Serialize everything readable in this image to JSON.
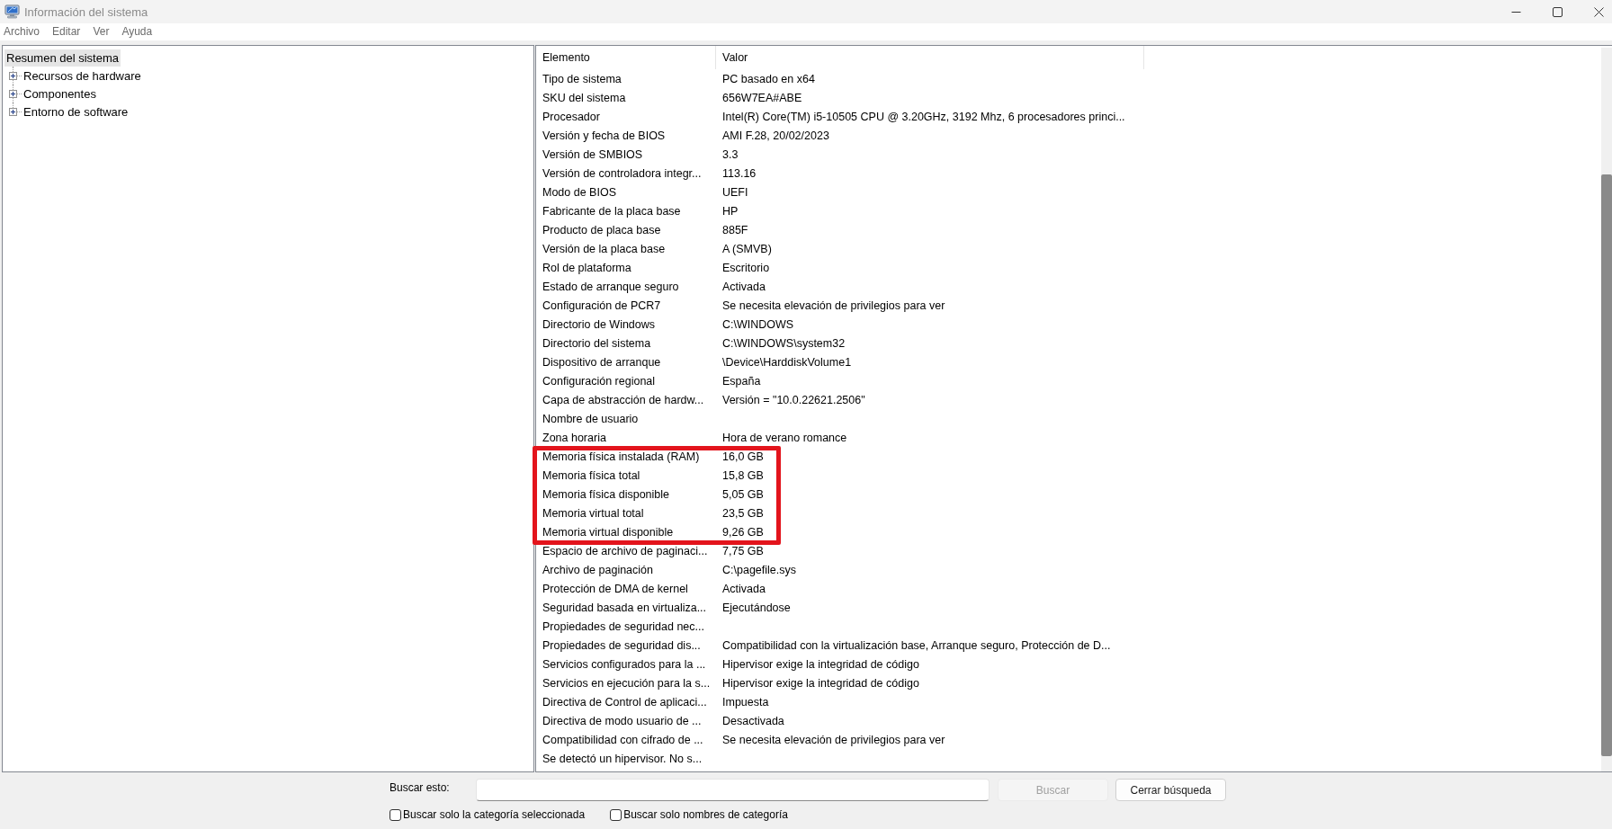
{
  "window": {
    "title": "Información del sistema"
  },
  "menu": [
    "Archivo",
    "Editar",
    "Ver",
    "Ayuda"
  ],
  "tree": [
    {
      "label": "Resumen del sistema",
      "selected": true,
      "children": [
        {
          "label": "Recursos de hardware",
          "selected": false,
          "expanded": false
        },
        {
          "label": "Componentes",
          "selected": false,
          "expanded": false
        },
        {
          "label": "Entorno de software",
          "selected": false,
          "expanded": false
        }
      ]
    }
  ],
  "table": {
    "columns": [
      "Elemento",
      "Valor"
    ],
    "rows": [
      {
        "element": "Tipo de sistema",
        "value": "PC basado en x64",
        "highlighted": false
      },
      {
        "element": "SKU del sistema",
        "value": "656W7EA#ABE",
        "highlighted": false
      },
      {
        "element": "Procesador",
        "value": "Intel(R) Core(TM) i5-10505 CPU @ 3.20GHz, 3192 Mhz, 6 procesadores princi...",
        "highlighted": false
      },
      {
        "element": "Versión y fecha de BIOS",
        "value": "AMI F.28, 20/02/2023",
        "highlighted": false
      },
      {
        "element": "Versión de SMBIOS",
        "value": "3.3",
        "highlighted": false
      },
      {
        "element": "Versión de controladora integr...",
        "value": "113.16",
        "highlighted": false
      },
      {
        "element": "Modo de BIOS",
        "value": "UEFI",
        "highlighted": false
      },
      {
        "element": "Fabricante de la placa base",
        "value": "HP",
        "highlighted": false
      },
      {
        "element": "Producto de placa base",
        "value": "885F",
        "highlighted": false
      },
      {
        "element": "Versión de la placa base",
        "value": "A (SMVB)",
        "highlighted": false
      },
      {
        "element": "Rol de plataforma",
        "value": "Escritorio",
        "highlighted": false
      },
      {
        "element": "Estado de arranque seguro",
        "value": "Activada",
        "highlighted": false
      },
      {
        "element": "Configuración de PCR7",
        "value": "Se necesita elevación de privilegios para ver",
        "highlighted": false
      },
      {
        "element": "Directorio de Windows",
        "value": "C:\\WINDOWS",
        "highlighted": false
      },
      {
        "element": "Directorio del sistema",
        "value": "C:\\WINDOWS\\system32",
        "highlighted": false
      },
      {
        "element": "Dispositivo de arranque",
        "value": "\\Device\\HarddiskVolume1",
        "highlighted": false
      },
      {
        "element": "Configuración regional",
        "value": "España",
        "highlighted": false
      },
      {
        "element": "Capa de abstracción de hardw...",
        "value": "Versión = \"10.0.22621.2506\"",
        "highlighted": false
      },
      {
        "element": "Nombre de usuario",
        "highlighted": false
      },
      {
        "element": "Zona horaria",
        "value": "Hora de verano romance",
        "highlighted": false
      },
      {
        "element": "Memoria física instalada (RAM)",
        "value": "16,0 GB",
        "highlighted": true
      },
      {
        "element": "Memoria física total",
        "value": "15,8 GB",
        "highlighted": true
      },
      {
        "element": "Memoria física disponible",
        "value": "5,05 GB",
        "highlighted": true
      },
      {
        "element": "Memoria virtual total",
        "value": "23,5 GB",
        "highlighted": true
      },
      {
        "element": "Memoria virtual disponible",
        "value": "9,26 GB",
        "highlighted": true
      },
      {
        "element": "Espacio de archivo de paginaci...",
        "value": "7,75 GB",
        "highlighted": false
      },
      {
        "element": "Archivo de paginación",
        "value": "C:\\pagefile.sys",
        "highlighted": false
      },
      {
        "element": "Protección de DMA de kernel",
        "value": "Activada",
        "highlighted": false
      },
      {
        "element": "Seguridad basada en virtualiza...",
        "value": "Ejecutándose",
        "highlighted": false
      },
      {
        "element": "Propiedades de seguridad nec...",
        "highlighted": false
      },
      {
        "element": "Propiedades de seguridad dis...",
        "value": "Compatibilidad con la virtualización base, Arranque seguro, Protección de D...",
        "highlighted": false
      },
      {
        "element": "Servicios configurados para la ...",
        "value": "Hipervisor exige la integridad de código",
        "highlighted": false
      },
      {
        "element": "Servicios en ejecución para la s...",
        "value": "Hipervisor exige la integridad de código",
        "highlighted": false
      },
      {
        "element": "Directiva de Control de aplicaci...",
        "value": "Impuesta",
        "highlighted": false
      },
      {
        "element": "Directiva de modo usuario de ...",
        "value": "Desactivada",
        "highlighted": false
      },
      {
        "element": "Compatibilidad con cifrado de ...",
        "value": "Se necesita elevación de privilegios para ver",
        "highlighted": false
      },
      {
        "element": "Se detectó un hipervisor. No s...",
        "highlighted": false
      }
    ]
  },
  "search": {
    "label": "Buscar esto:",
    "buttons": [
      {
        "label": "Buscar",
        "disabled": true
      },
      {
        "label": "Cerrar búsqueda",
        "disabled": false
      }
    ],
    "options": [
      {
        "label": "Buscar solo la categoría seleccionada",
        "checked": false
      },
      {
        "label": "Buscar solo nombres de categoría",
        "checked": false
      }
    ]
  }
}
